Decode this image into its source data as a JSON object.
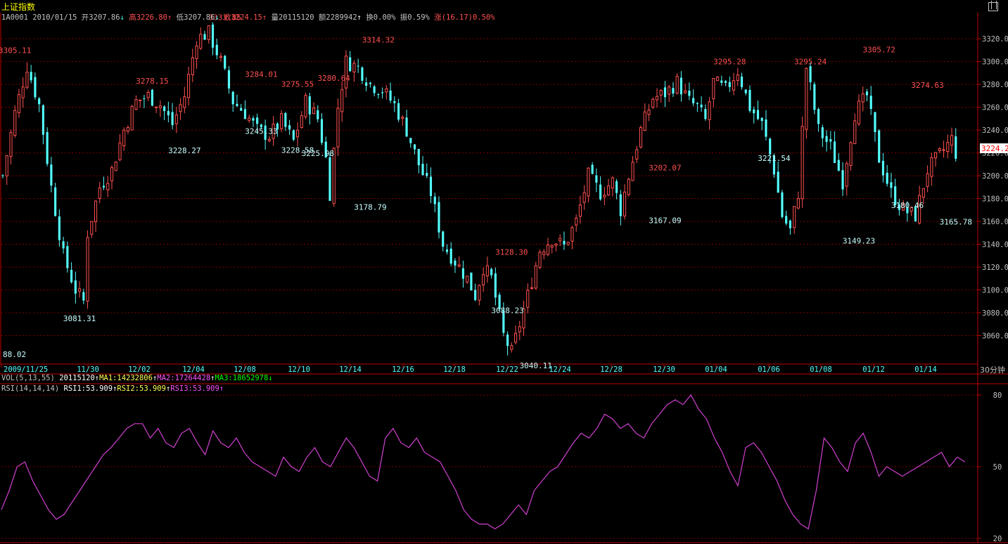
{
  "header": {
    "title": "上证指数",
    "code_date": "1A0001 2010/01/15",
    "open": "开3207.86",
    "high": "高3226.80",
    "low": "低3207.86",
    "close": "收3224.15",
    "volume": "量20115120",
    "amount": "额2289942",
    "turnover": "换0.00%",
    "amplitude": "振0.59%",
    "change": "涨(16.17)0.50%"
  },
  "volume_indicator": {
    "label": "VOL(5,13,55)",
    "value": "20115120",
    "ma1": "MA1:14232806",
    "ma2": "MA2:17264428",
    "ma3": "MA3:18652978"
  },
  "rsi_indicator": {
    "label": "RSI(14,14,14)",
    "rsi1": "RSI1:53.909",
    "rsi2": "RSI2:53.909",
    "rsi3": "RSI3:53.909"
  },
  "price_axis": {
    "ticks": [
      "3320.0",
      "3300.0",
      "3280.0",
      "3260.0",
      "3240.0",
      "3220.0",
      "3200.0",
      "3180.0",
      "3160.0",
      "3140.0",
      "3120.0",
      "3100.0",
      "3080.0",
      "3060.0"
    ],
    "current_price_tag": "3224.2"
  },
  "date_axis": {
    "ticks": [
      "2009/11/25",
      "11/30",
      "12/02",
      "12/04",
      "12/08",
      "12/10",
      "12/14",
      "12/16",
      "12/18",
      "12/22",
      "12/24",
      "12/28",
      "12/30",
      "01/04",
      "01/06",
      "01/08",
      "01/12",
      "01/14"
    ],
    "period": "30分钟"
  },
  "rsi_axis": {
    "ticks": [
      "80",
      "50",
      "20"
    ]
  },
  "colors": {
    "background": "#000000",
    "up": "#ff5050",
    "down": "#54ffff",
    "frame": "#c00000",
    "rsi_line": "#d040d0",
    "grid": "#800000"
  },
  "chart_data": [
    {
      "type": "candlestick",
      "title": "上证指数",
      "ylim": [
        3040,
        3333
      ],
      "y_ticks": [
        3060,
        3080,
        3100,
        3120,
        3140,
        3160,
        3180,
        3200,
        3220,
        3240,
        3260,
        3280,
        3300,
        3320
      ],
      "x_ticks": [
        "2009/11/25",
        "11/30",
        "12/02",
        "12/04",
        "12/08",
        "12/10",
        "12/14",
        "12/16",
        "12/18",
        "12/22",
        "12/24",
        "12/28",
        "12/30",
        "01/04",
        "01/06",
        "01/08",
        "01/12",
        "01/14"
      ],
      "close_path": [
        [
          0,
          3200
        ],
        [
          3,
          3255
        ],
        [
          6,
          3296
        ],
        [
          9,
          3262
        ],
        [
          12,
          3190
        ],
        [
          15,
          3130
        ],
        [
          18,
          3100
        ],
        [
          20,
          3090
        ],
        [
          21,
          3150
        ],
        [
          24,
          3190
        ],
        [
          27,
          3205
        ],
        [
          30,
          3240
        ],
        [
          33,
          3265
        ],
        [
          36,
          3270
        ],
        [
          39,
          3262
        ],
        [
          42,
          3245
        ],
        [
          45,
          3270
        ],
        [
          48,
          3320
        ],
        [
          51,
          3325
        ],
        [
          54,
          3300
        ],
        [
          57,
          3265
        ],
        [
          60,
          3255
        ],
        [
          63,
          3240
        ],
        [
          66,
          3235
        ],
        [
          69,
          3248
        ],
        [
          72,
          3230
        ],
        [
          75,
          3265
        ],
        [
          78,
          3250
        ],
        [
          80,
          3215
        ],
        [
          81,
          3185
        ],
        [
          83,
          3260
        ],
        [
          85,
          3300
        ],
        [
          88,
          3295
        ],
        [
          91,
          3280
        ],
        [
          94,
          3275
        ],
        [
          97,
          3262
        ],
        [
          100,
          3240
        ],
        [
          103,
          3210
        ],
        [
          106,
          3185
        ],
        [
          109,
          3140
        ],
        [
          112,
          3125
        ],
        [
          115,
          3110
        ],
        [
          117,
          3095
        ],
        [
          119,
          3120
        ],
        [
          121,
          3110
        ],
        [
          124,
          3060
        ],
        [
          126,
          3045
        ],
        [
          128,
          3070
        ],
        [
          130,
          3095
        ],
        [
          133,
          3135
        ],
        [
          136,
          3145
        ],
        [
          139,
          3138
        ],
        [
          142,
          3160
        ],
        [
          145,
          3200
        ],
        [
          148,
          3185
        ],
        [
          151,
          3195
        ],
        [
          153,
          3170
        ],
        [
          155,
          3200
        ],
        [
          158,
          3240
        ],
        [
          161,
          3268
        ],
        [
          164,
          3272
        ],
        [
          167,
          3282
        ],
        [
          170,
          3265
        ],
        [
          172,
          3260
        ],
        [
          174,
          3248
        ],
        [
          176,
          3282
        ],
        [
          179,
          3275
        ],
        [
          182,
          3292
        ],
        [
          185,
          3260
        ],
        [
          188,
          3245
        ],
        [
          191,
          3205
        ],
        [
          193,
          3165
        ],
        [
          195,
          3152
        ],
        [
          197,
          3185
        ],
        [
          199,
          3295
        ],
        [
          202,
          3240
        ],
        [
          205,
          3225
        ],
        [
          208,
          3195
        ],
        [
          211,
          3255
        ],
        [
          214,
          3270
        ],
        [
          217,
          3215
        ],
        [
          220,
          3185
        ],
        [
          223,
          3170
        ],
        [
          226,
          3165
        ],
        [
          229,
          3205
        ],
        [
          232,
          3218
        ],
        [
          235,
          3232
        ],
        [
          236,
          3220
        ]
      ],
      "annotations": [
        {
          "x": 3,
          "value": "3305.11",
          "kind": "high"
        },
        {
          "x": 0,
          "value": "88.02",
          "kind": "low"
        },
        {
          "x": 19,
          "value": "3081.31",
          "kind": "low"
        },
        {
          "x": 37,
          "value": "3278.15",
          "kind": "high"
        },
        {
          "x": 45,
          "value": "3228.27",
          "kind": "low"
        },
        {
          "x": 55,
          "value": "3333.85",
          "kind": "high"
        },
        {
          "x": 64,
          "value": "3284.01",
          "kind": "high"
        },
        {
          "x": 64,
          "value": "3245.33",
          "kind": "low"
        },
        {
          "x": 73,
          "value": "3275.55",
          "kind": "high"
        },
        {
          "x": 73,
          "value": "3228.58",
          "kind": "low"
        },
        {
          "x": 78,
          "value": "3225.98",
          "kind": "low"
        },
        {
          "x": 82,
          "value": "3280.64",
          "kind": "high"
        },
        {
          "x": 91,
          "value": "3178.79",
          "kind": "low"
        },
        {
          "x": 93,
          "value": "3314.32",
          "kind": "high"
        },
        {
          "x": 126,
          "value": "3128.30",
          "kind": "high"
        },
        {
          "x": 125,
          "value": "3088.23",
          "kind": "low"
        },
        {
          "x": 132,
          "value": "3040.11",
          "kind": "low"
        },
        {
          "x": 164,
          "value": "3202.07",
          "kind": "high"
        },
        {
          "x": 164,
          "value": "3167.09",
          "kind": "low"
        },
        {
          "x": 180,
          "value": "3295.28",
          "kind": "high"
        },
        {
          "x": 191,
          "value": "3221.54",
          "kind": "low"
        },
        {
          "x": 200,
          "value": "3295.24",
          "kind": "high"
        },
        {
          "x": 212,
          "value": "3149.23",
          "kind": "low"
        },
        {
          "x": 217,
          "value": "3305.72",
          "kind": "high"
        },
        {
          "x": 224,
          "value": "3180.46",
          "kind": "low"
        },
        {
          "x": 229,
          "value": "3274.63",
          "kind": "high"
        },
        {
          "x": 236,
          "value": "3165.78",
          "kind": "low"
        }
      ]
    },
    {
      "type": "line",
      "title": "RSI(14,14,14)",
      "ylim": [
        20,
        80
      ],
      "y_ticks": [
        20,
        50,
        80
      ],
      "series": [
        {
          "name": "RSI3",
          "values": [
            32,
            40,
            50,
            52,
            44,
            38,
            32,
            28,
            30,
            35,
            40,
            45,
            50,
            55,
            58,
            62,
            66,
            68,
            68,
            62,
            66,
            60,
            58,
            64,
            66,
            60,
            55,
            65,
            60,
            58,
            62,
            56,
            52,
            50,
            48,
            46,
            54,
            50,
            48,
            54,
            58,
            52,
            50,
            56,
            62,
            58,
            52,
            46,
            44,
            62,
            66,
            60,
            58,
            62,
            56,
            54,
            52,
            46,
            40,
            32,
            28,
            26,
            26,
            24,
            26,
            30,
            34,
            30,
            40,
            44,
            48,
            50,
            55,
            60,
            64,
            62,
            66,
            72,
            70,
            66,
            68,
            64,
            62,
            68,
            72,
            76,
            78,
            76,
            80,
            74,
            70,
            62,
            56,
            48,
            42,
            58,
            60,
            56,
            50,
            44,
            36,
            30,
            26,
            24,
            40,
            62,
            58,
            52,
            48,
            60,
            64,
            56,
            46,
            50,
            48,
            46,
            48,
            50,
            52,
            54,
            56,
            50,
            54,
            52
          ]
        }
      ]
    }
  ]
}
